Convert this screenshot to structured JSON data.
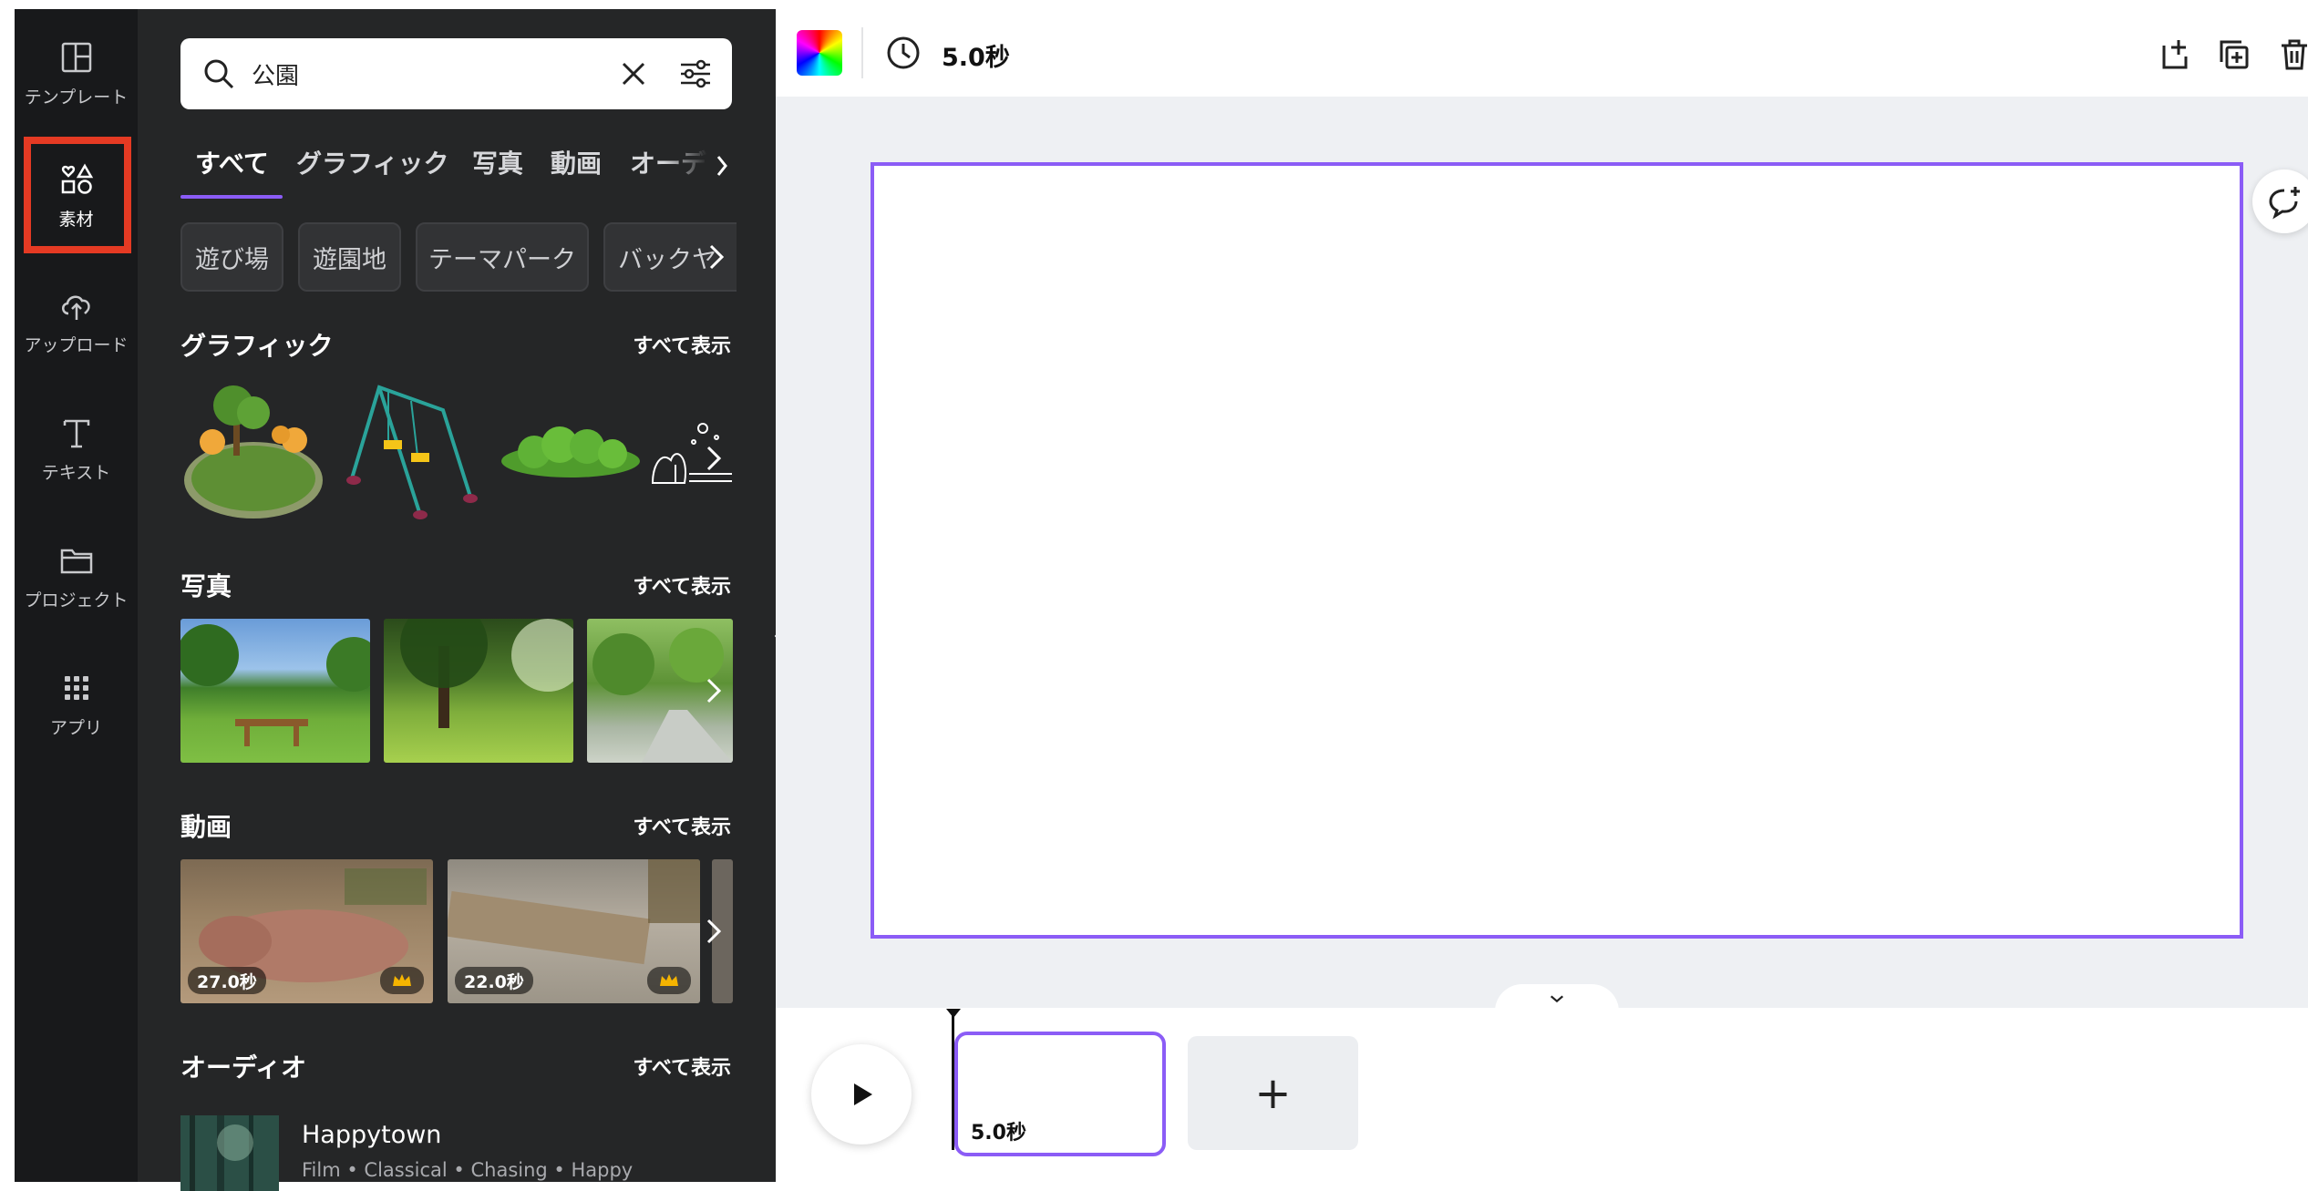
{
  "rail": {
    "items": [
      {
        "label": "テンプレート",
        "icon": "layout-icon"
      },
      {
        "label": "素材",
        "icon": "shapes-icon"
      },
      {
        "label": "アップロード",
        "icon": "cloud-upload-icon"
      },
      {
        "label": "テキスト",
        "icon": "text-icon"
      },
      {
        "label": "プロジェクト",
        "icon": "folder-icon"
      },
      {
        "label": "アプリ",
        "icon": "apps-grid-icon"
      }
    ],
    "active": "素材",
    "highlight_color": "#e53a23"
  },
  "search": {
    "value": "公園",
    "placeholder": ""
  },
  "tabs": [
    "すべて",
    "グラフィック",
    "写真",
    "動画",
    "オーデ"
  ],
  "active_tab": "すべて",
  "chips": [
    "遊び場",
    "遊園地",
    "テーマパーク",
    "バックヤ"
  ],
  "sections": {
    "graphics": {
      "title": "グラフィック",
      "see_all": "すべて表示"
    },
    "photos": {
      "title": "写真",
      "see_all": "すべて表示"
    },
    "videos": {
      "title": "動画",
      "see_all": "すべて表示",
      "items": [
        {
          "duration": "27.0秒"
        },
        {
          "duration": "22.0秒"
        }
      ]
    },
    "audio": {
      "title": "オーディオ",
      "see_all": "すべて表示",
      "track": {
        "title": "Happytown",
        "tags": "Film • Classical • Chasing • Happy"
      }
    }
  },
  "topbar": {
    "duration": "5.0秒"
  },
  "timeline": {
    "clip_duration": "5.0秒",
    "add_label": "+"
  },
  "colors": {
    "accent": "#8b5cf6",
    "panel_bg": "#252627",
    "rail_bg": "#18191b",
    "canvas_bg": "#eef0f3"
  }
}
